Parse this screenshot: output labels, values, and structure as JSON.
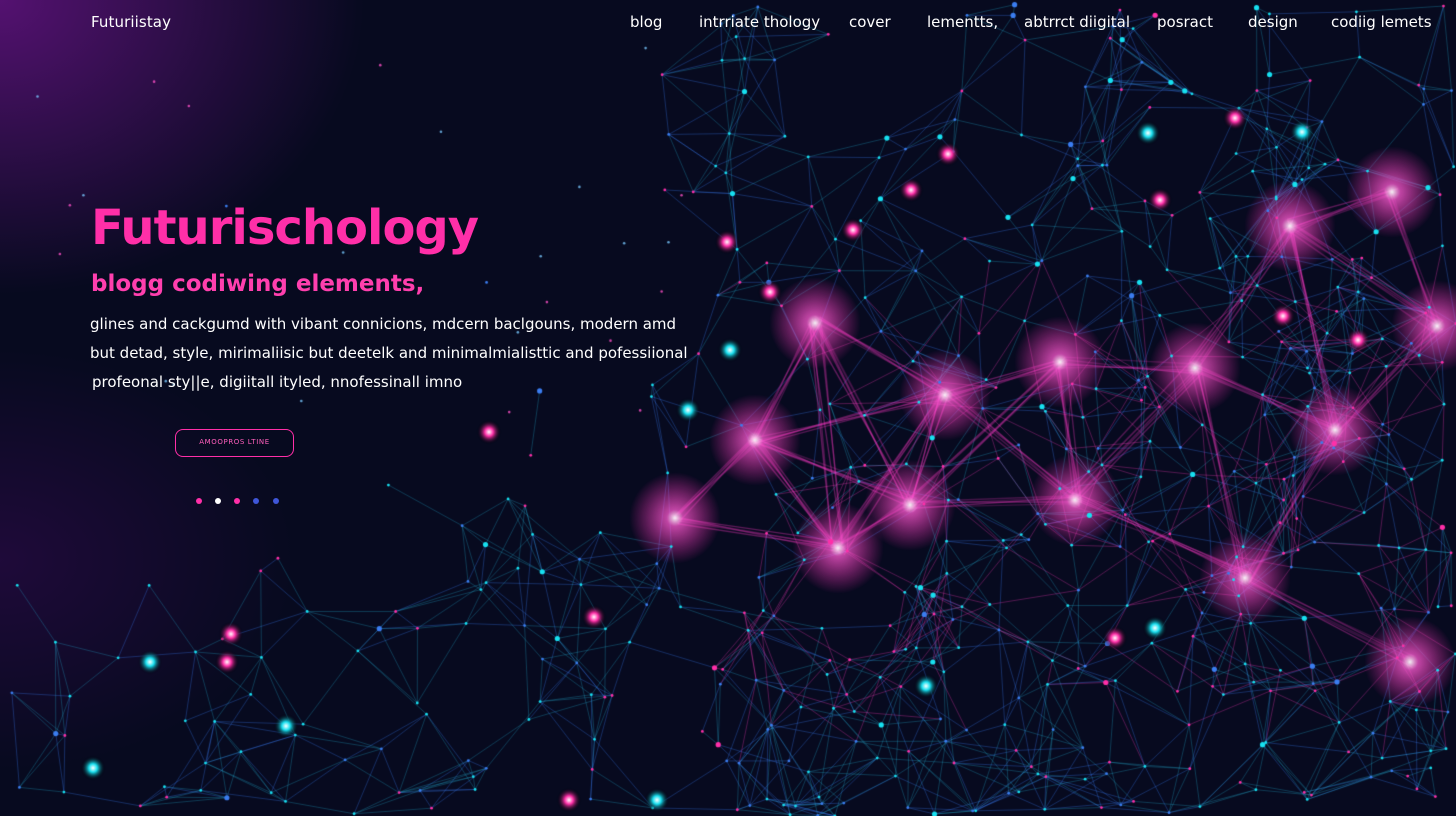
{
  "brand": "Futuriistay",
  "nav": [
    "blog",
    "intrriate thology",
    "cover",
    "lementts,",
    "abtrrct diigital",
    "posract",
    "design",
    "codiig lemets"
  ],
  "hero": {
    "title": "Futurischology",
    "subtitle": "blogg codiwing elements,",
    "lines": [
      "glines and cackgumd with vibant connicions, mdcern baclgouns, modern amd",
      "but detad, style, mirimaliisic  but deetelk  and minimalmialisttic and pofessiional",
      "profeonal sty||e, digiitall ityled, nnofessinall imno"
    ],
    "cta": "AMOOPROS LTINE"
  },
  "carousel": {
    "dot_colors": [
      "#ff2fa8",
      "#ffffff",
      "#ff2fa8",
      "#3f56d8",
      "#3f56d8"
    ],
    "active_index": 1
  },
  "colors": {
    "accent_pink": "#ff2fa8",
    "accent_cyan": "#17e0f0",
    "line_blue": "#3b7df0",
    "background": "#070a1f"
  }
}
